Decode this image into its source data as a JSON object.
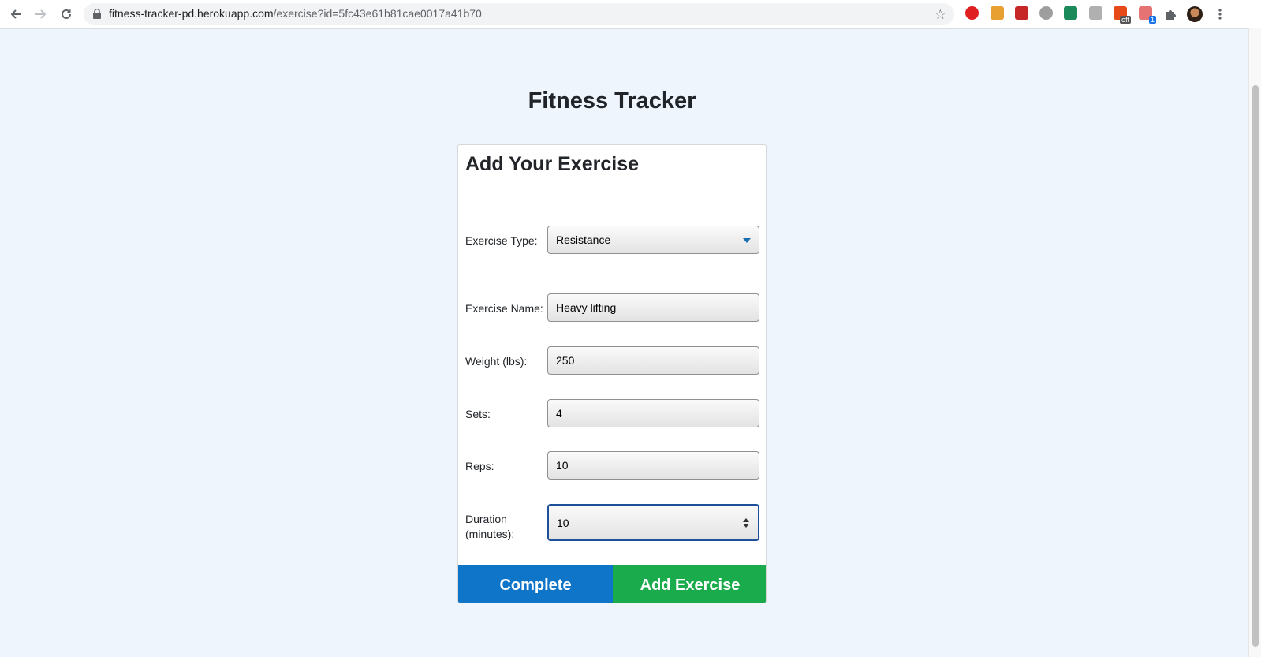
{
  "browser": {
    "url_host": "fitness-tracker-pd.herokuapp.com",
    "url_path": "/exercise?id=5fc43e61b81cae0017a41b70",
    "extensions": [
      {
        "name": "extension-red-icon",
        "color": "#e02020"
      },
      {
        "name": "extension-rainbow-icon",
        "color": "#e8a030"
      },
      {
        "name": "extension-red-book-icon",
        "color": "#c62828"
      },
      {
        "name": "extension-gray-bubble-icon",
        "color": "#9e9e9e"
      },
      {
        "name": "extension-green-icon",
        "color": "#1b8a5a"
      },
      {
        "name": "extension-gray-icon",
        "color": "#b0b0b0"
      },
      {
        "name": "extension-off-badge-icon",
        "color": "#e64a19",
        "badge": "off"
      },
      {
        "name": "extension-blue-badge-icon",
        "color": "#e57373",
        "badge": "1"
      }
    ]
  },
  "page": {
    "title": "Fitness Tracker",
    "form": {
      "heading": "Add Your Exercise",
      "exercise_type": {
        "label": "Exercise Type:",
        "value": "Resistance"
      },
      "exercise_name": {
        "label": "Exercise Name:",
        "value": "Heavy lifting"
      },
      "weight": {
        "label": "Weight (lbs):",
        "value": "250"
      },
      "sets": {
        "label": "Sets:",
        "value": "4"
      },
      "reps": {
        "label": "Reps:",
        "value": "10"
      },
      "duration": {
        "label_line1": "Duration",
        "label_line2": "(minutes):",
        "value": "10"
      }
    },
    "buttons": {
      "complete": "Complete",
      "add_exercise": "Add Exercise"
    }
  },
  "colors": {
    "background": "#eef5fd",
    "complete_button": "#0e75c9",
    "add_button": "#1aab4c"
  }
}
